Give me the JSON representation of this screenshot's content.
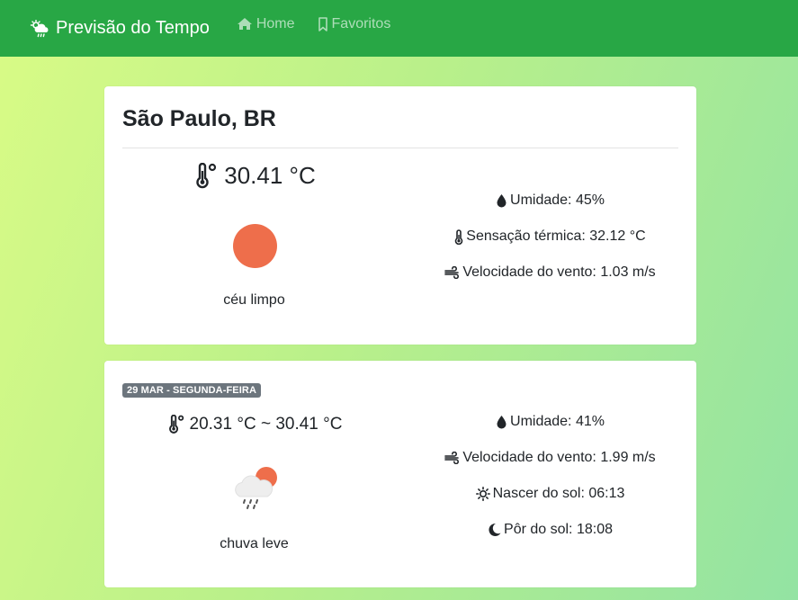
{
  "nav": {
    "brand": "Previsão do Tempo",
    "home": "Home",
    "favorites": "Favoritos"
  },
  "current": {
    "city": "São Paulo, BR",
    "temperature": "30.41 °C",
    "description": "céu limpo",
    "humidity": "Umidade: 45%",
    "feels_like": "Sensação térmica: 32.12 °C",
    "wind": "Velocidade do vento: 1.03 m/s",
    "icon": "sun-icon"
  },
  "forecast": [
    {
      "date": "29 MAR - SEGUNDA-FEIRA",
      "temp_range": "20.31 °C ~ 30.41 °C",
      "description": "chuva leve",
      "humidity": "Umidade: 41%",
      "wind": "Velocidade do vento: 1.99 m/s",
      "sunrise": "Nascer do sol: 06:13",
      "sunset": "Pôr do sol: 18:08",
      "icon": "light-rain-icon"
    }
  ],
  "colors": {
    "navbar": "#28a745",
    "badge": "#6c757d",
    "sun": "#ee6e4b"
  }
}
